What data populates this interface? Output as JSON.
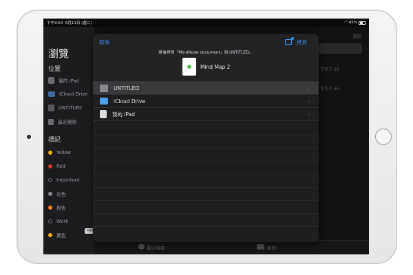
{
  "statusbar": {
    "time": "下午9:54",
    "date": "6月11日 (週二)",
    "battery": "45%"
  },
  "sidebar": {
    "title": "瀏覽",
    "locations_header": "位置",
    "locations": [
      {
        "label": "我的 iPad"
      },
      {
        "label": "iCloud Drive"
      },
      {
        "label": "UNTITLED"
      },
      {
        "label": "最近刪除"
      }
    ],
    "tags_header": "標記",
    "tags": [
      {
        "label": "Yellow",
        "color": "#e7b31a"
      },
      {
        "label": "Red",
        "color": "#d23a32"
      },
      {
        "label": "Important",
        "color": ""
      },
      {
        "label": "灰色",
        "color": "#8a8a8e"
      },
      {
        "label": "橙色",
        "color": "#e58a2b"
      },
      {
        "label": "Work",
        "color": ""
      },
      {
        "label": "黃色",
        "color": "#e7b31a"
      }
    ]
  },
  "background": {
    "select": "選取",
    "time1": "下午7:36",
    "time2": "下午7:36",
    "recents_tab": "最近項目",
    "browse_tab": "瀏覽"
  },
  "watermark": "MRMAD.COM.TW",
  "modal": {
    "cancel": "取消",
    "copy": "拷貝",
    "subtitle": "將會拷貝「MindNode document」到 UNTITLED。",
    "document_name": "Mind Map 2",
    "rows": [
      {
        "label": "UNTITLED",
        "icon": "usb-drive-icon"
      },
      {
        "label": "iCloud Drive",
        "icon": "icloud-icon"
      },
      {
        "label": "我的 iPad",
        "icon": "ipad-icon"
      }
    ]
  }
}
